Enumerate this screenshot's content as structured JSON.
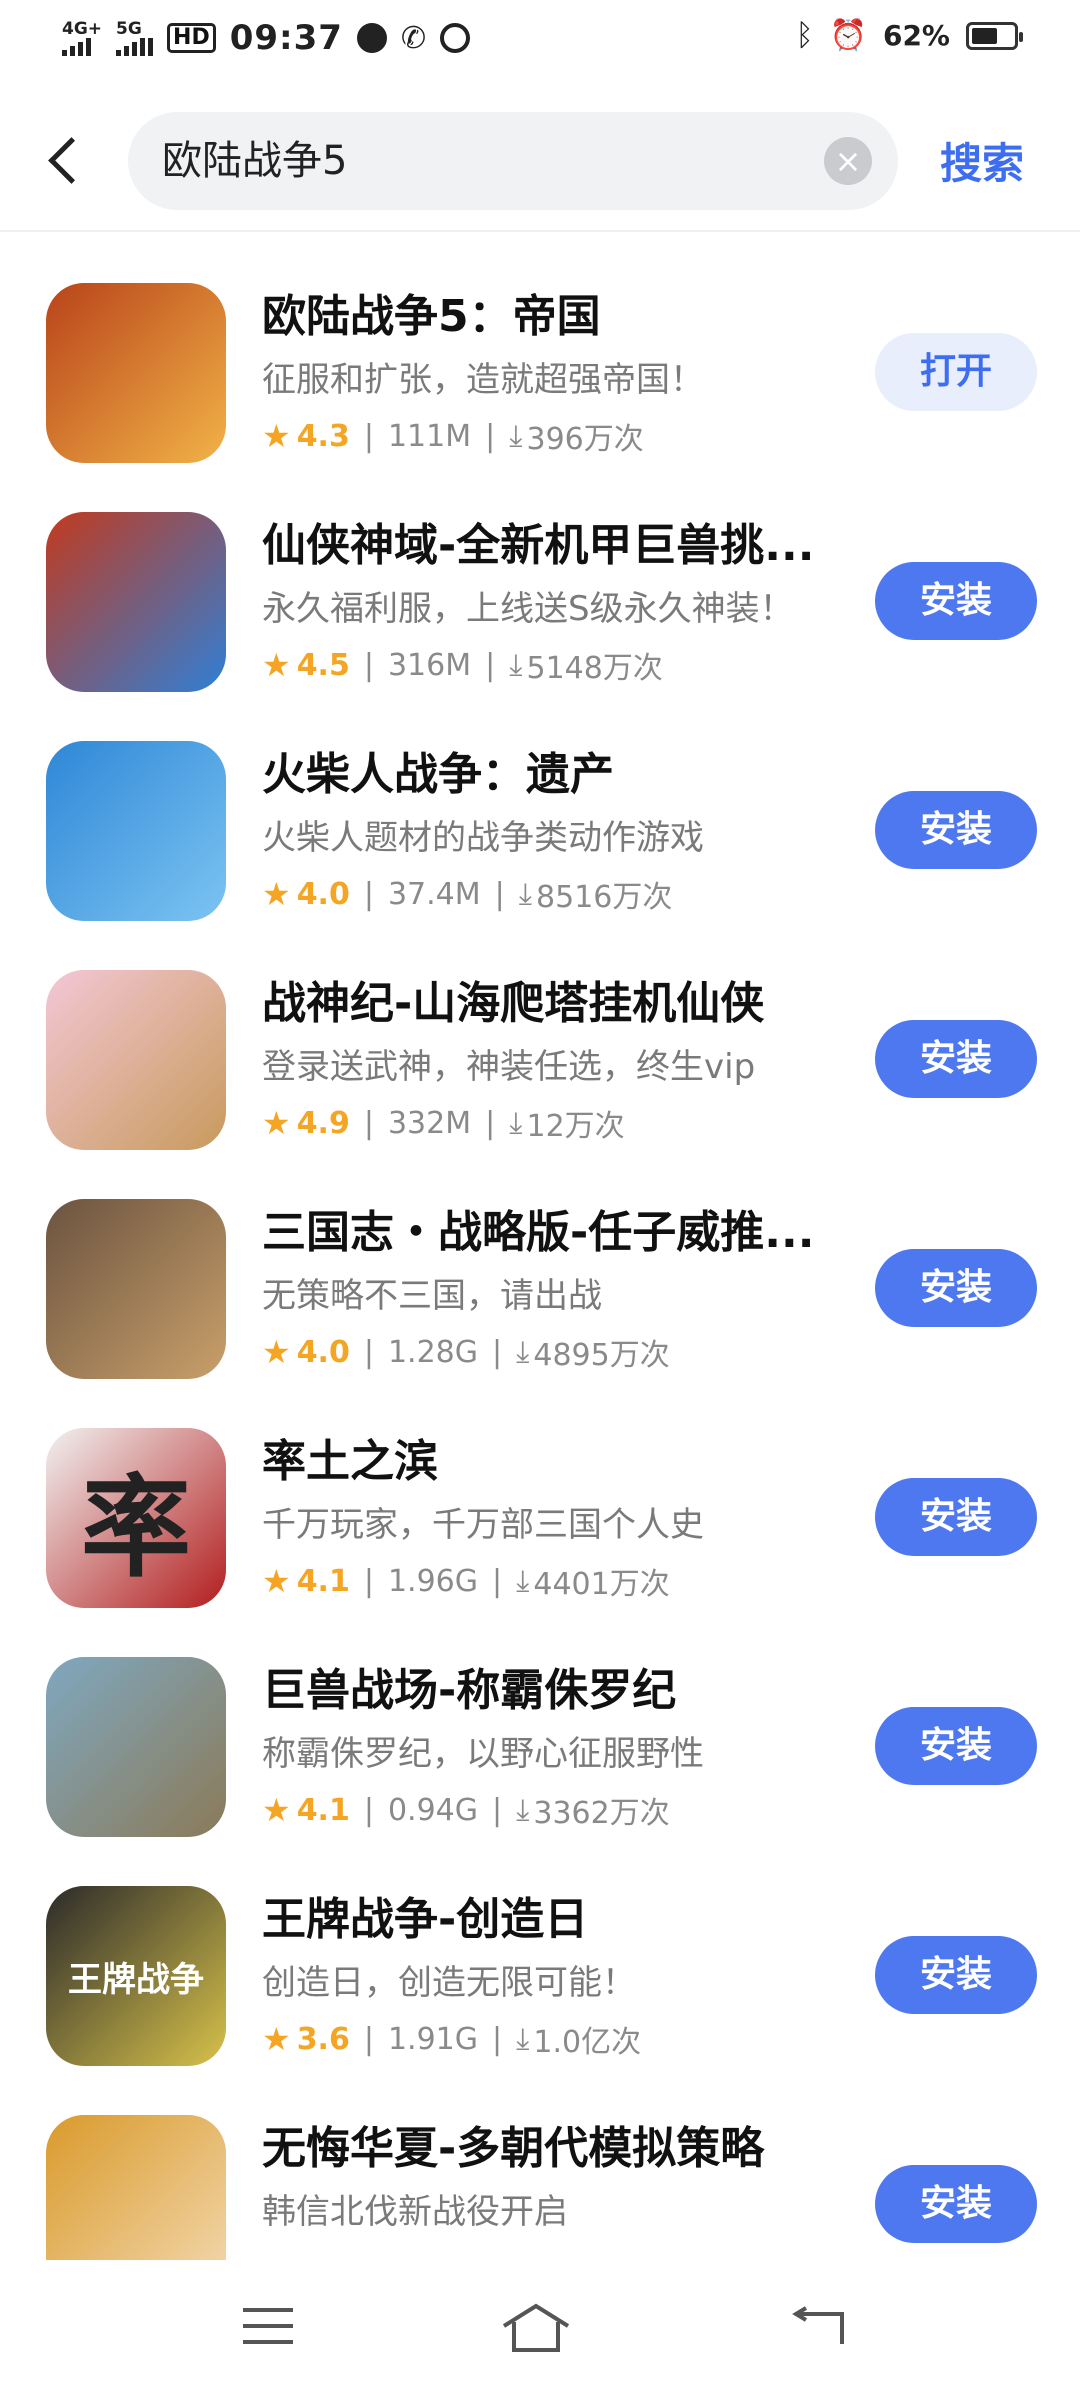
{
  "status_bar": {
    "network_1": "4G+",
    "network_2": "5G",
    "hd_label": "HD",
    "time": "09:37",
    "battery_percent": "62%",
    "battery_level": 0.62,
    "icons": [
      "signal-icon",
      "hd-voice-icon",
      "timer-icon",
      "call-icon",
      "shield-icon",
      "bluetooth-icon",
      "alarm-icon",
      "battery-icon"
    ]
  },
  "header": {
    "search_value": "欧陆战争5",
    "search_button": "搜索",
    "clear_icon": "close-icon",
    "back_icon": "back-arrow-icon"
  },
  "apps": [
    {
      "name": "欧陆战争5：帝国",
      "desc": "征服和扩张，造就超强帝国！",
      "rating": "4.3",
      "size": "111M",
      "downloads": "396万次",
      "action": "打开",
      "action_type": "open",
      "icon_colors": [
        "#b8431a",
        "#f2b347"
      ]
    },
    {
      "name": "仙侠神域-全新机甲巨兽挑...",
      "desc": "永久福利服，上线送S级永久神装！",
      "rating": "4.5",
      "size": "316M",
      "downloads": "5148万次",
      "action": "安装",
      "action_type": "install",
      "icon_colors": [
        "#c23a1e",
        "#2f7fd6"
      ]
    },
    {
      "name": "火柴人战争：遗产",
      "desc": "火柴人题材的战争类动作游戏",
      "rating": "4.0",
      "size": "37.4M",
      "downloads": "8516万次",
      "action": "安装",
      "action_type": "install",
      "icon_colors": [
        "#2e87d6",
        "#7cc4f2"
      ]
    },
    {
      "name": "战神纪-山海爬塔挂机仙侠",
      "desc": "登录送武神，神装任选，终生vip",
      "rating": "4.9",
      "size": "332M",
      "downloads": "12万次",
      "action": "安装",
      "action_type": "install",
      "icon_colors": [
        "#f3c7d6",
        "#c89a5c"
      ]
    },
    {
      "name": "三国志・战略版-任子威推...",
      "desc": "无策略不三国，请出战",
      "rating": "4.0",
      "size": "1.28G",
      "downloads": "4895万次",
      "action": "安装",
      "action_type": "install",
      "icon_colors": [
        "#6b5340",
        "#c9a06a"
      ]
    },
    {
      "name": "率土之滨",
      "desc": "千万玩家，千万部三国个人史",
      "rating": "4.1",
      "size": "1.96G",
      "downloads": "4401万次",
      "action": "安装",
      "action_type": "install",
      "icon_colors": [
        "#f2f2f2",
        "#b21d1d"
      ],
      "icon_glyph": "率"
    },
    {
      "name": "巨兽战场-称霸侏罗纪",
      "desc": "称霸侏罗纪，以野心征服野性",
      "rating": "4.1",
      "size": "0.94G",
      "downloads": "3362万次",
      "action": "安装",
      "action_type": "install",
      "icon_colors": [
        "#7fa8c0",
        "#8b7a58"
      ]
    },
    {
      "name": "王牌战争-创造日",
      "desc": "创造日，创造无限可能！",
      "rating": "3.6",
      "size": "1.91G",
      "downloads": "1.0亿次",
      "action": "安装",
      "action_type": "install",
      "icon_colors": [
        "#2a2a2a",
        "#d8c24a"
      ],
      "icon_glyph": "王牌战争"
    },
    {
      "name": "无悔华夏-多朝代模拟策略",
      "desc": "韩信北伐新战役开启",
      "rating": "",
      "size": "",
      "downloads": "",
      "action": "安装",
      "action_type": "install",
      "icon_colors": [
        "#d99a2b",
        "#f3d9b1"
      ]
    }
  ],
  "nav": {
    "icons": [
      "menu-icon",
      "home-icon",
      "back-icon"
    ]
  }
}
